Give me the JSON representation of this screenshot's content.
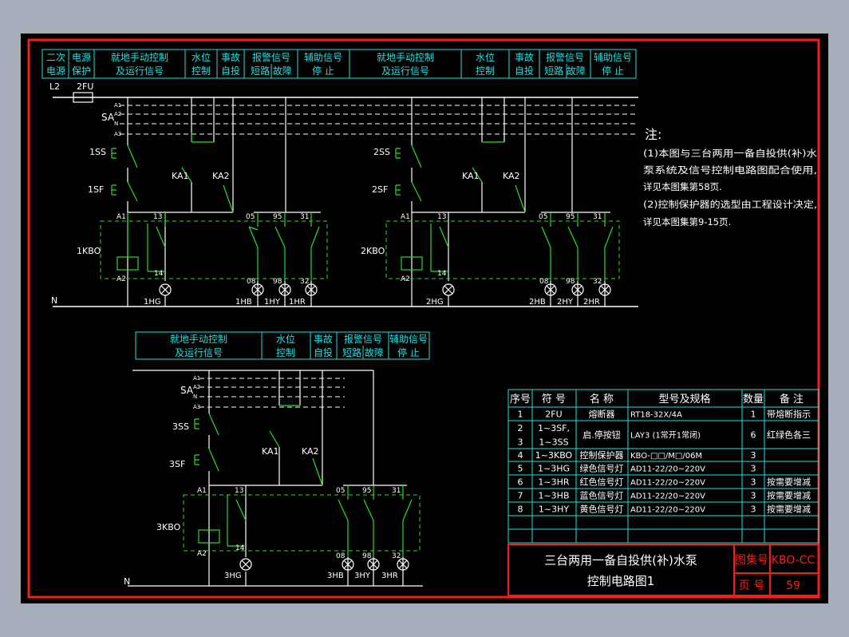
{
  "colors": {
    "background": "#000000",
    "frame": "#ff1a1a",
    "cyan": "#20e0e0",
    "green": "#25e025",
    "white": "#ffffff",
    "desktop": "#a4adb9"
  },
  "header_top": {
    "left": [
      "二次电源",
      "电源保护",
      "就地手动控制及运行信号",
      "水位控制",
      "事故自投",
      "报警信号短路",
      "报警信号故障",
      "辅助信号停止"
    ],
    "cells": [
      {
        "l1": "二次",
        "l2": "电源"
      },
      {
        "l1": "电源",
        "l2": "保护"
      },
      {
        "l1": "就地手动控制",
        "l2": "及运行信号"
      },
      {
        "l1": "水位",
        "l2": "控制"
      },
      {
        "l1": "事故",
        "l2": "自投"
      },
      {
        "l1": "报警信号",
        "l2": "短路 故障"
      },
      {
        "l1": "辅助信号",
        "l2": "停  止"
      },
      {
        "l1": "就地手动控制",
        "l2": "及运行信号"
      },
      {
        "l1": "水位",
        "l2": "控制"
      },
      {
        "l1": "事故",
        "l2": "自投"
      },
      {
        "l1": "报警信号",
        "l2": "短路 故障"
      },
      {
        "l1": "辅助信号",
        "l2": "停  止"
      }
    ]
  },
  "header_bottom": {
    "cells": [
      {
        "l1": "就地手动控制",
        "l2": "及运行信号"
      },
      {
        "l1": "水位",
        "l2": "控制"
      },
      {
        "l1": "事故",
        "l2": "自投"
      },
      {
        "l1": "报警信号",
        "l2": "短路 故障"
      },
      {
        "l1": "辅助信号",
        "l2": "停  止"
      }
    ]
  },
  "circuit_labels": {
    "l2": "L2",
    "fuse": "2FU",
    "sa": "SA",
    "bus": [
      "A1",
      "A2",
      "N",
      "A3"
    ],
    "n": "N",
    "ka1": "KA1",
    "ka2": "KA2",
    "a1": "A1",
    "a2": "A2",
    "t13": "13",
    "t14": "14",
    "t05": "05",
    "t08": "08",
    "t95": "95",
    "t98": "98",
    "t31": "31",
    "t32": "32"
  },
  "units": [
    {
      "ss": "1SS",
      "sf": "1SF",
      "kbo": "1KBO",
      "hg": "1HG",
      "hb": "1HB",
      "hy": "1HY",
      "hr": "1HR"
    },
    {
      "ss": "2SS",
      "sf": "2SF",
      "kbo": "2KBO",
      "hg": "2HG",
      "hb": "2HB",
      "hy": "2HY",
      "hr": "2HR"
    },
    {
      "ss": "3SS",
      "sf": "3SF",
      "kbo": "3KBO",
      "hg": "3HG",
      "hb": "3HB",
      "hy": "3HY",
      "hr": "3HR"
    }
  ],
  "notes": {
    "title": "注:",
    "lines": [
      "(1)本图与三台两用一备自投供(补)水",
      "   泵系统及信号控制电路图配合使用,",
      "   详见本图集第58页.",
      "(2)控制保护器的选型由工程设计决定,",
      "   详见本图集第9-15页."
    ]
  },
  "parts_table": {
    "headers": [
      "序号",
      "符 号",
      "名 称",
      "型号及规格",
      "数量",
      "备 注"
    ],
    "rows": [
      {
        "no": "1",
        "sym": "2FU",
        "name": "熔断器",
        "spec": "RT18-32X/4A",
        "qty": "1",
        "note": "带熔断指示"
      },
      {
        "no": "2\n3",
        "sym": "1~3SF,\n1~3SS",
        "name": "启.停按钮",
        "spec": "LAY3  (1常开1常闭)",
        "qty": "6",
        "note": "红绿色各三"
      },
      {
        "no": "4",
        "sym": "1~3KBO",
        "name": "控制保护器",
        "spec": "KBO-□□/M□/06M",
        "qty": "3",
        "note": ""
      },
      {
        "no": "5",
        "sym": "1~3HG",
        "name": "绿色信号灯",
        "spec": "AD11-22/20~220V",
        "qty": "3",
        "note": ""
      },
      {
        "no": "6",
        "sym": "1~3HR",
        "name": "红色信号灯",
        "spec": "AD11-22/20~220V",
        "qty": "3",
        "note": "按需要增减"
      },
      {
        "no": "7",
        "sym": "1~3HB",
        "name": "蓝色信号灯",
        "spec": "AD11-22/20~220V",
        "qty": "3",
        "note": "按需要增减"
      },
      {
        "no": "8",
        "sym": "1~3HY",
        "name": "黄色信号灯",
        "spec": "AD11-22/20~220V",
        "qty": "3",
        "note": "按需要增减"
      }
    ]
  },
  "title_block": {
    "title1": "三台两用一备自投供(补)水泵",
    "title2": "控制电路图1",
    "atlas_label": "图集号",
    "atlas_value": "KBO-CC",
    "page_label": "页 号",
    "page_value": "59"
  }
}
